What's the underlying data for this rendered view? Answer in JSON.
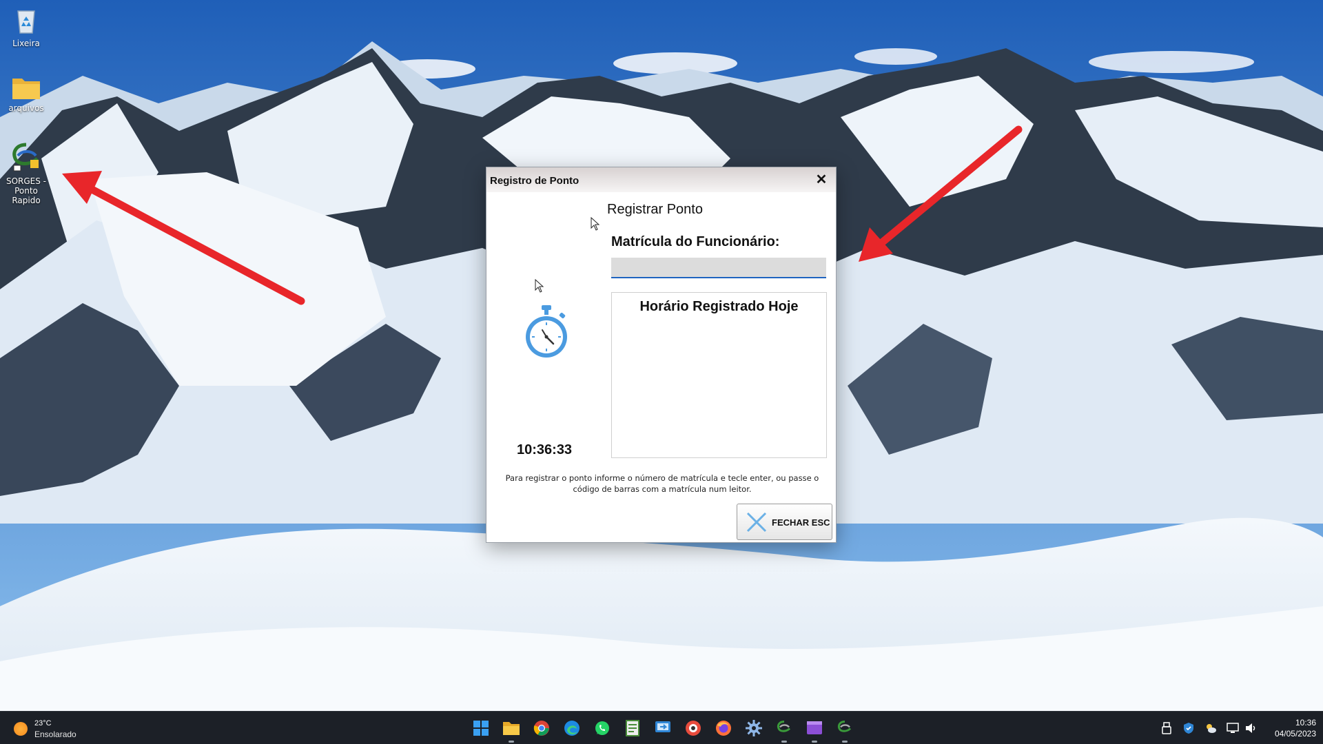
{
  "desktop": {
    "icons": [
      {
        "label": "Lixeira",
        "icon": "recycle-bin-icon"
      },
      {
        "label": "arquivos",
        "icon": "folder-icon"
      },
      {
        "label": "SORGES - Ponto Rapido",
        "icon": "sorges-app-icon"
      }
    ]
  },
  "dialog": {
    "title": "Registro de Ponto",
    "close_glyph": "✕",
    "heading": "Registrar Ponto",
    "field_label": "Matrícula do Funcionário:",
    "field_value": "",
    "clock_icon": "stopwatch-icon",
    "clock_text": "10:36:33",
    "registered_title": "Horário Registrado Hoje",
    "instructions": "Para registrar o ponto informe o número de matrícula e tecle enter, ou passe o código de barras com a matrícula num leitor.",
    "close_button_label": "FECHAR ESC",
    "close_button_icon": "x-icon"
  },
  "taskbar": {
    "weather": {
      "temp": "23°C",
      "desc": "Ensolarado",
      "icon": "sun-icon"
    },
    "apps": [
      {
        "name": "start-button",
        "icon": "windows-icon",
        "running": false
      },
      {
        "name": "file-explorer",
        "icon": "folder-icon",
        "running": true
      },
      {
        "name": "chrome",
        "icon": "chrome-icon",
        "running": false
      },
      {
        "name": "edge",
        "icon": "edge-icon",
        "running": false
      },
      {
        "name": "whatsapp",
        "icon": "whatsapp-icon",
        "running": false
      },
      {
        "name": "notepad-app",
        "icon": "document-icon",
        "running": false
      },
      {
        "name": "remote-app",
        "icon": "remote-icon",
        "running": false
      },
      {
        "name": "red-app",
        "icon": "red-app-icon",
        "running": false
      },
      {
        "name": "firefox",
        "icon": "firefox-icon",
        "running": false
      },
      {
        "name": "settings",
        "icon": "gear-icon",
        "running": false
      },
      {
        "name": "sorges-1",
        "icon": "sorges-app-icon",
        "running": true
      },
      {
        "name": "clipchamp",
        "icon": "video-icon",
        "running": true
      },
      {
        "name": "sorges-2",
        "icon": "sorges-app-icon",
        "running": true
      }
    ],
    "tray": {
      "time": "10:36",
      "date": "04/05/2023"
    }
  },
  "colors": {
    "arrow": "#e8262a",
    "taskbar": "#1c2027",
    "input_underline": "#1f64c0",
    "stopwatch": "#4b9be0"
  }
}
